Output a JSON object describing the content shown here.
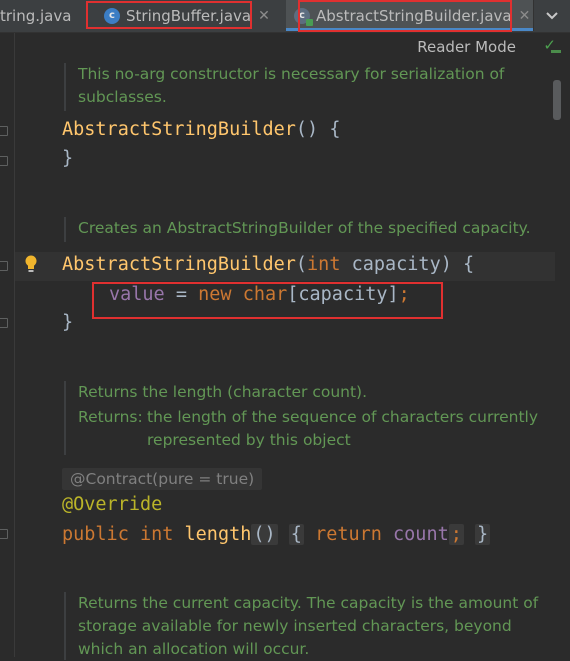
{
  "tabs": [
    {
      "label": "tring.java",
      "active": false
    },
    {
      "label": "StringBuffer.java",
      "active": false,
      "icon": "java-class-icon"
    },
    {
      "label": "AbstractStringBuilder.java",
      "active": true,
      "icon": "java-abstract-class-icon"
    }
  ],
  "toolbar": {
    "reader_mode": "Reader Mode",
    "check_icon": "checkmark-icon",
    "menu_icon": "chevron-down-icon"
  },
  "blocks": {
    "ctor_doc": [
      "This no-arg constructor is necessary for serialization of",
      "subclasses."
    ],
    "ctor_sig": "AbstractStringBuilder",
    "ctor_close": "}",
    "cap_doc": "Creates an AbstractStringBuilder of the specified capacity.",
    "cap_sig_name": "AbstractStringBuilder",
    "cap_sig_kw": "int",
    "cap_sig_param": "capacity",
    "cap_body_field": "value",
    "cap_body_new": "new",
    "cap_body_type": "char",
    "cap_body_arg": "capacity",
    "len_doc_1": "Returns the length (character count).",
    "len_doc_returns_label": "Returns:",
    "len_doc_returns_text": [
      "the length of the sequence of characters currently",
      "represented by this object"
    ],
    "len_contract": "@Contract(pure = true)",
    "len_override": "@Override",
    "len_sig_public": "public",
    "len_sig_int": "int",
    "len_sig_name": "length",
    "len_body_return": "return",
    "len_body_field": "count",
    "capacity_doc": [
      "Returns the current capacity. The capacity is the amount of",
      "storage available for newly inserted characters, beyond",
      "which an allocation will occur."
    ]
  },
  "colors": {
    "background": "#2b2b2b",
    "keyword": "#cc7832",
    "method": "#ffc66d",
    "field": "#9876aa",
    "annotation": "#bbb529",
    "doc": "#629755",
    "highlight_box": "#e03030"
  }
}
